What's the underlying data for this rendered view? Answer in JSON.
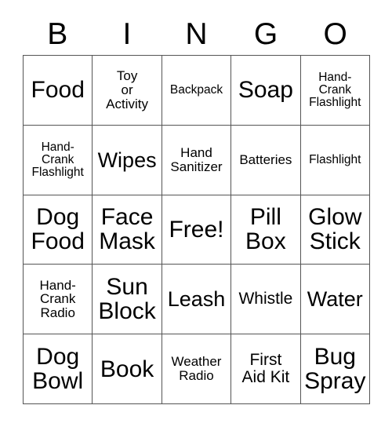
{
  "card": {
    "title": "BINGO",
    "header_letters": [
      "B",
      "I",
      "N",
      "G",
      "O"
    ],
    "free_space_label": "Free!",
    "background_color": "#ffffff",
    "text_color": "#000000",
    "border_color": "#555555",
    "rows": [
      [
        {
          "label": "Food",
          "size": "xl"
        },
        {
          "label": "Toy\nor\nActivity",
          "size": "sm"
        },
        {
          "label": "Backpack",
          "size": "xs"
        },
        {
          "label": "Soap",
          "size": "xl"
        },
        {
          "label": "Hand-\nCrank\nFlashlight",
          "size": "xs"
        }
      ],
      [
        {
          "label": "Hand-\nCrank\nFlashlight",
          "size": "xs"
        },
        {
          "label": "Wipes",
          "size": "lg"
        },
        {
          "label": "Hand\nSanitizer",
          "size": "sm"
        },
        {
          "label": "Batteries",
          "size": "sm"
        },
        {
          "label": "Flashlight",
          "size": "xs"
        }
      ],
      [
        {
          "label": "Dog\nFood",
          "size": "xl"
        },
        {
          "label": "Face\nMask",
          "size": "xl"
        },
        {
          "label": "Free!",
          "size": "xl"
        },
        {
          "label": "Pill\nBox",
          "size": "xl"
        },
        {
          "label": "Glow\nStick",
          "size": "xl"
        }
      ],
      [
        {
          "label": "Hand-\nCrank\nRadio",
          "size": "sm"
        },
        {
          "label": "Sun\nBlock",
          "size": "xl"
        },
        {
          "label": "Leash",
          "size": "lg"
        },
        {
          "label": "Whistle",
          "size": "md"
        },
        {
          "label": "Water",
          "size": "lg"
        }
      ],
      [
        {
          "label": "Dog\nBowl",
          "size": "xl"
        },
        {
          "label": "Book",
          "size": "xl"
        },
        {
          "label": "Weather\nRadio",
          "size": "sm"
        },
        {
          "label": "First\nAid Kit",
          "size": "md"
        },
        {
          "label": "Bug\nSpray",
          "size": "xl"
        }
      ]
    ]
  }
}
